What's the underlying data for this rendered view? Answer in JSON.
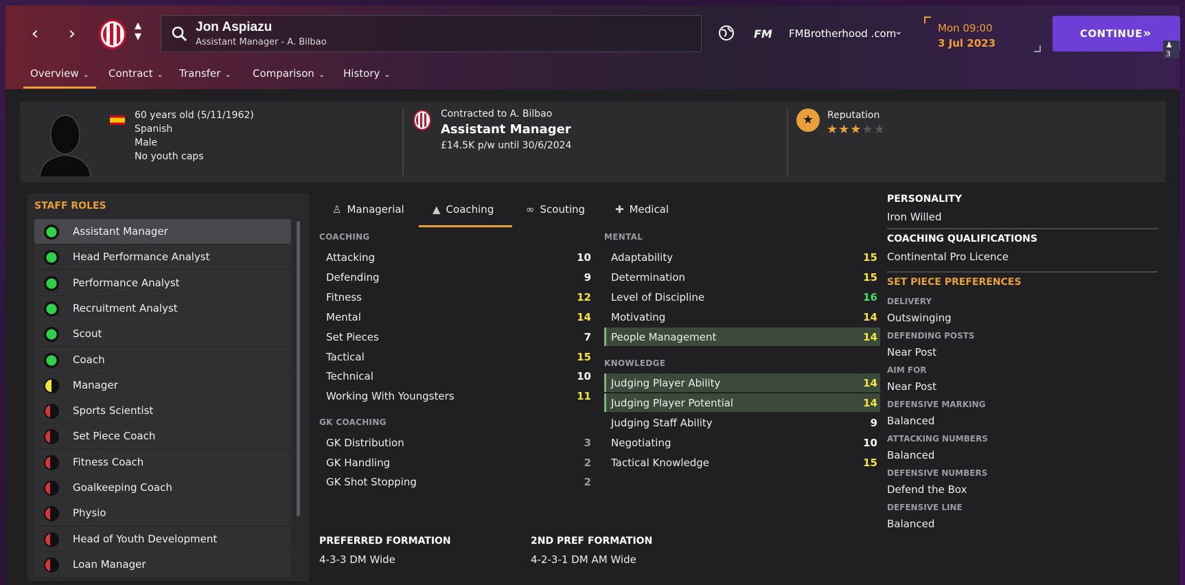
{
  "header": {
    "back_glyph": "‹",
    "forward_glyph": "›",
    "person_name": "Jon Aspiazu",
    "person_subtitle": "Assistant Manager - A. Bilbao",
    "fm_logo": "FM",
    "user_name": "FMBrotherhood .com",
    "date_day": "Mon 09:00",
    "date_date": "3 Jul 2023",
    "continue_label": "CONTINUE",
    "message_count": "3"
  },
  "top_tabs": [
    {
      "label": "Overview"
    },
    {
      "label": "Contract"
    },
    {
      "label": "Transfer"
    },
    {
      "label": "Comparison"
    },
    {
      "label": "History"
    }
  ],
  "profile": {
    "age": "60 years old (5/11/1962)",
    "nationality": "Spanish",
    "gender": "Male",
    "youth_caps": "No youth caps",
    "contracted_to": "Contracted to A. Bilbao",
    "role": "Assistant Manager",
    "wage": "£14.5K p/w until 30/6/2024",
    "reputation_label": "Reputation",
    "reputation_stars": 3,
    "reputation_max": 5
  },
  "staff_roles": {
    "title": "STAFF ROLES",
    "items": [
      {
        "label": "Assistant Manager",
        "status": "green",
        "selected": true
      },
      {
        "label": "Head Performance Analyst",
        "status": "green"
      },
      {
        "label": "Performance Analyst",
        "status": "green"
      },
      {
        "label": "Recruitment Analyst",
        "status": "green"
      },
      {
        "label": "Scout",
        "status": "green"
      },
      {
        "label": "Coach",
        "status": "green"
      },
      {
        "label": "Manager",
        "status": "yellow"
      },
      {
        "label": "Sports Scientist",
        "status": "red"
      },
      {
        "label": "Set Piece Coach",
        "status": "red"
      },
      {
        "label": "Fitness Coach",
        "status": "red"
      },
      {
        "label": "Goalkeeping Coach",
        "status": "red"
      },
      {
        "label": "Physio",
        "status": "red"
      },
      {
        "label": "Head of Youth Development",
        "status": "red"
      },
      {
        "label": "Loan Manager",
        "status": "red"
      }
    ]
  },
  "sub_tabs": [
    {
      "label": "Managerial",
      "icon": "managerial-icon"
    },
    {
      "label": "Coaching",
      "icon": "coaching-cone-icon"
    },
    {
      "label": "Scouting",
      "icon": "binoculars-icon"
    },
    {
      "label": "Medical",
      "icon": "medical-kit-icon"
    }
  ],
  "coaching": {
    "title": "COACHING",
    "rows": [
      {
        "name": "Attacking",
        "value": "10",
        "color": "white"
      },
      {
        "name": "Defending",
        "value": "9",
        "color": "white"
      },
      {
        "name": "Fitness",
        "value": "12",
        "color": "yellow"
      },
      {
        "name": "Mental",
        "value": "14",
        "color": "yellow"
      },
      {
        "name": "Set Pieces",
        "value": "7",
        "color": "white"
      },
      {
        "name": "Tactical",
        "value": "15",
        "color": "yellow"
      },
      {
        "name": "Technical",
        "value": "10",
        "color": "white"
      },
      {
        "name": "Working With Youngsters",
        "value": "11",
        "color": "yellow"
      }
    ]
  },
  "gk_coaching": {
    "title": "GK COACHING",
    "rows": [
      {
        "name": "GK Distribution",
        "value": "3",
        "color": "grey"
      },
      {
        "name": "GK Handling",
        "value": "2",
        "color": "grey"
      },
      {
        "name": "GK Shot Stopping",
        "value": "2",
        "color": "grey"
      }
    ]
  },
  "mental": {
    "title": "MENTAL",
    "rows": [
      {
        "name": "Adaptability",
        "value": "15",
        "color": "yellow"
      },
      {
        "name": "Determination",
        "value": "15",
        "color": "yellow"
      },
      {
        "name": "Level of Discipline",
        "value": "16",
        "color": "green"
      },
      {
        "name": "Motivating",
        "value": "14",
        "color": "yellow"
      },
      {
        "name": "People Management",
        "value": "14",
        "color": "yellow",
        "highlight": true
      }
    ]
  },
  "knowledge": {
    "title": "KNOWLEDGE",
    "rows": [
      {
        "name": "Judging Player Ability",
        "value": "14",
        "color": "yellow",
        "highlight": true
      },
      {
        "name": "Judging Player Potential",
        "value": "14",
        "color": "yellow",
        "highlight": true
      },
      {
        "name": "Judging Staff Ability",
        "value": "9",
        "color": "white"
      },
      {
        "name": "Negotiating",
        "value": "10",
        "color": "white"
      },
      {
        "name": "Tactical Knowledge",
        "value": "15",
        "color": "yellow"
      }
    ]
  },
  "formations": {
    "preferred_label": "PREFERRED FORMATION",
    "preferred_value": "4-3-3 DM Wide",
    "second_label": "2ND PREF FORMATION",
    "second_value": "4-2-3-1 DM AM Wide"
  },
  "personality": {
    "title": "PERSONALITY",
    "value": "Iron Willed",
    "qual_title": "COACHING QUALIFICATIONS",
    "qual_value": "Continental Pro Licence",
    "set_piece_title": "SET PIECE PREFERENCES",
    "prefs": [
      {
        "label": "DELIVERY",
        "value": "Outswinging"
      },
      {
        "label": "DEFENDING POSTS",
        "value": "Near Post"
      },
      {
        "label": "AIM FOR",
        "value": "Near Post"
      },
      {
        "label": "DEFENSIVE MARKING",
        "value": "Balanced"
      },
      {
        "label": "ATTACKING NUMBERS",
        "value": "Balanced"
      },
      {
        "label": "DEFENSIVE NUMBERS",
        "value": "Defend the Box"
      },
      {
        "label": "DEFENSIVE LINE",
        "value": "Balanced"
      }
    ]
  },
  "colors": {
    "accent": "#e8a13a",
    "continue_button": "#6d3fd6",
    "value_green": "#3ee06a",
    "value_yellow": "#f5e23c",
    "role_green": "#2fd14a",
    "role_yellow": "#f2e23a",
    "role_red": "#d9343a"
  }
}
